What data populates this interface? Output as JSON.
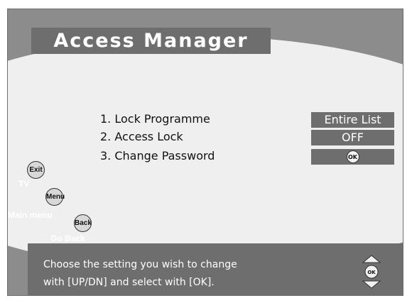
{
  "title": "Access Manager",
  "menu": {
    "items": [
      {
        "label": "1. Lock Programme",
        "value": "Entire List"
      },
      {
        "label": "2. Access Lock",
        "value": "OFF"
      },
      {
        "label": "3. Change Password",
        "value_icon": "ok-button-icon",
        "value_text": "OK"
      }
    ]
  },
  "buttons": {
    "exit": {
      "label": "Exit",
      "caption": "TV"
    },
    "menu": {
      "label": "Menu",
      "caption": "Main menu"
    },
    "back": {
      "label": "Back",
      "caption": "Go Back"
    }
  },
  "help": {
    "line1": "Choose the setting you wish to change",
    "line2": "with [UP/DN] and select with [OK].",
    "nav_ok": "OK"
  },
  "colors": {
    "background": "#8c8c8c",
    "panel": "#efefef",
    "bar": "#6e6e6e",
    "text_light": "#ffffff",
    "text_dark": "#111111"
  }
}
